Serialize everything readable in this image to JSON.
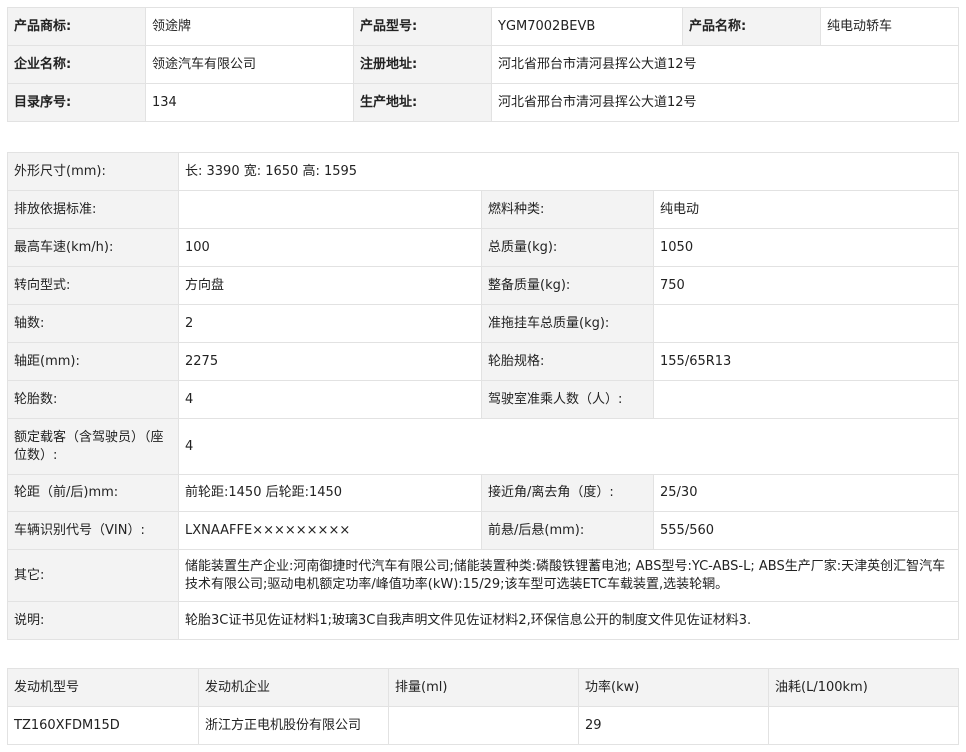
{
  "basic": {
    "brand_label": "产品商标:",
    "brand_value": "领途牌",
    "model_label": "产品型号:",
    "model_value": "YGM7002BEVB",
    "name_label": "产品名称:",
    "name_value": "纯电动轿车",
    "company_label": "企业名称:",
    "company_value": "领途汽车有限公司",
    "reg_addr_label": "注册地址:",
    "reg_addr_value": "河北省邢台市清河县挥公大道12号",
    "catalog_label": "目录序号:",
    "catalog_value": "134",
    "prod_addr_label": "生产地址:",
    "prod_addr_value": "河北省邢台市清河县挥公大道12号"
  },
  "specs": {
    "dims_label": "外形尺寸(mm):",
    "dims_value": "长: 3390 宽: 1650 高: 1595",
    "emission_label": "排放依据标准:",
    "emission_value": "",
    "fuel_label": "燃料种类:",
    "fuel_value": "纯电动",
    "speed_label": "最高车速(km/h):",
    "speed_value": "100",
    "total_mass_label": "总质量(kg):",
    "total_mass_value": "1050",
    "steering_label": "转向型式:",
    "steering_value": "方向盘",
    "curb_mass_label": "整备质量(kg):",
    "curb_mass_value": "750",
    "axles_label": "轴数:",
    "axles_value": "2",
    "trailer_label": "准拖挂车总质量(kg):",
    "trailer_value": "",
    "wheelbase_label": "轴距(mm):",
    "wheelbase_value": "2275",
    "tire_spec_label": "轮胎规格:",
    "tire_spec_value": "155/65R13",
    "tire_count_label": "轮胎数:",
    "tire_count_value": "4",
    "cab_label": "驾驶室准乘人数（人）:",
    "cab_value": "",
    "seats_label": "额定载客（含驾驶员）（座位数）:",
    "seats_value": "4",
    "track_label": "轮距（前/后)mm:",
    "track_value": "前轮距:1450 后轮距:1450",
    "angle_label": "接近角/离去角（度）:",
    "angle_value": "25/30",
    "vin_label": "车辆识别代号（VIN）:",
    "vin_value": "LXNAAFFE×××××××××",
    "overhang_label": "前悬/后悬(mm):",
    "overhang_value": "555/560",
    "other_label": "其它:",
    "other_value": "储能装置生产企业:河南御捷时代汽车有限公司;储能装置种类:磷酸铁锂蓄电池; ABS型号:YC-ABS-L; ABS生产厂家:天津英创汇智汽车技术有限公司;驱动电机额定功率/峰值功率(kW):15/29;该车型可选装ETC车载装置,选装轮辋。",
    "note_label": "说明:",
    "note_value": "轮胎3C证书见佐证材料1;玻璃3C自我声明文件见佐证材料2,环保信息公开的制度文件见佐证材料3."
  },
  "engine": {
    "headers": [
      "发动机型号",
      "发动机企业",
      "排量(ml)",
      "功率(kw)",
      "油耗(L/100km)"
    ],
    "rows": [
      [
        "TZ160XFDM15D",
        "浙江方正电机股份有限公司",
        "",
        "29",
        ""
      ]
    ]
  }
}
